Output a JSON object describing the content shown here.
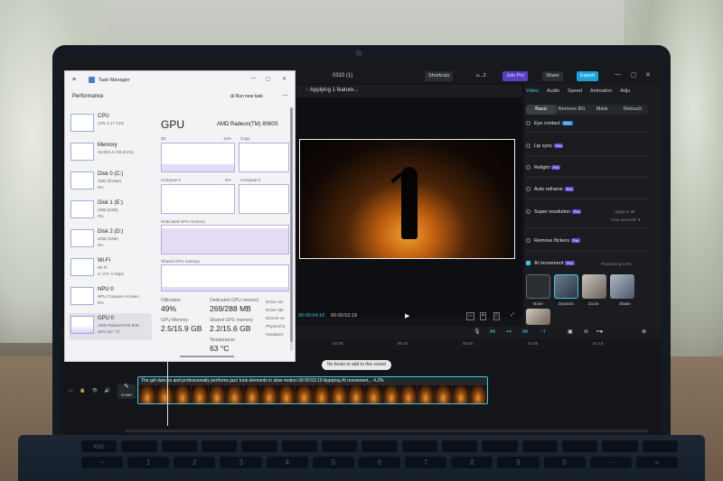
{
  "editor": {
    "project_title": "0310 (1)",
    "shortcuts": "Shortcuts",
    "user": "u...2",
    "join_pro": "Join Pro",
    "share": "Share",
    "export": "Export",
    "player_header": "Applying 1 feature...",
    "time_current": "00:00:04:19",
    "time_total": "00:00:53:19",
    "panel_tabs": [
      "Video",
      "Audio",
      "Speed",
      "Animation",
      "Adju"
    ],
    "sub_tabs": [
      "Basic",
      "Remove BG",
      "Mask",
      "Retouch"
    ],
    "features": {
      "eye_contact": "Eye contact",
      "lip_sync": "Lip sync",
      "relight": "Relight",
      "auto_reframe": "Auto reframe",
      "super_resolution": "Super resolution",
      "apply_to_all": "Apply to all",
      "free_uses": "Free uses left: 3",
      "remove_flickers": "Remove flickers",
      "ai_movement": "AI movement",
      "processing": "Processing 4.2%"
    },
    "badges": {
      "new": "New",
      "pro": "Pro"
    },
    "movement_styles": [
      "None",
      "Dynamic",
      "Zoom",
      "Shake"
    ],
    "ruler_ticks": [
      "00:30",
      "00:40",
      "00:50",
      "01:00",
      "01:10"
    ],
    "toast": "No beats to add to this sound",
    "clip_title": "The girl dances and professionally performs jazz funk elements in slow motion   00:00:53:19   Applying AI movement... 4.2%",
    "cover_label": "Cover",
    "accent": "#3ec9e0"
  },
  "task_manager": {
    "title": "Task Manager",
    "section": "Performance",
    "run_new_task": "Run new task",
    "sidebar": [
      {
        "name": "CPU",
        "sub": "13% 4.17 GHz",
        "sub2": ""
      },
      {
        "name": "Memory",
        "sub": "15.8/31.5 GB (51%)",
        "sub2": ""
      },
      {
        "name": "Disk 0 (C:)",
        "sub": "SSD (NVMe)",
        "sub2": "2%"
      },
      {
        "name": "Disk 1 (E:)",
        "sub": "USB (USB)",
        "sub2": "0%"
      },
      {
        "name": "Disk 2 (D:)",
        "sub": "USB (USB)",
        "sub2": "0%"
      },
      {
        "name": "Wi-Fi",
        "sub": "Wi-Fi",
        "sub2": "S: 0 R: 0 Kbps"
      },
      {
        "name": "NPU 0",
        "sub": "NPU Compute Acceler...",
        "sub2": "0%"
      },
      {
        "name": "GPU 0",
        "sub": "AMD Radeon(TM) 806...",
        "sub2": "49% (63 °C)"
      }
    ],
    "gpu_title": "GPU",
    "gpu_model": "AMD Radeon(TM) 8060S",
    "graph_labels": {
      "3d": "3D",
      "3d_pct": "12%",
      "copy": "Copy",
      "compute": "Compute 0",
      "compute_pct": "0%",
      "compute1": "Compute 0",
      "dedicated": "Dedicated GPU memory",
      "shared": "Shared GPU memory"
    },
    "stats": {
      "utilization_label": "Utilization",
      "utilization": "49%",
      "dedicated_label": "Dedicated GPU memory",
      "dedicated": "269/288 MB",
      "gpu_memory_label": "GPU Memory",
      "gpu_memory": "2.5/15.9 GB",
      "shared_label": "Shared GPU memory",
      "shared": "2.2/15.6 GB",
      "temperature_label": "Temperature",
      "temperature": "63 °C"
    },
    "side_info": [
      "Driver ver",
      "Driver dat",
      "DirectX ve",
      "Physical lo",
      "Hardware"
    ]
  },
  "keyboard": {
    "row1": [
      "esc",
      "",
      "",
      "",
      "",
      "",
      "",
      "",
      "",
      "",
      "",
      "",
      "",
      "",
      ""
    ],
    "row2": [
      "~",
      "1",
      "2",
      "3",
      "4",
      "5",
      "6",
      "7",
      "8",
      "9",
      "0",
      "-",
      "="
    ]
  }
}
